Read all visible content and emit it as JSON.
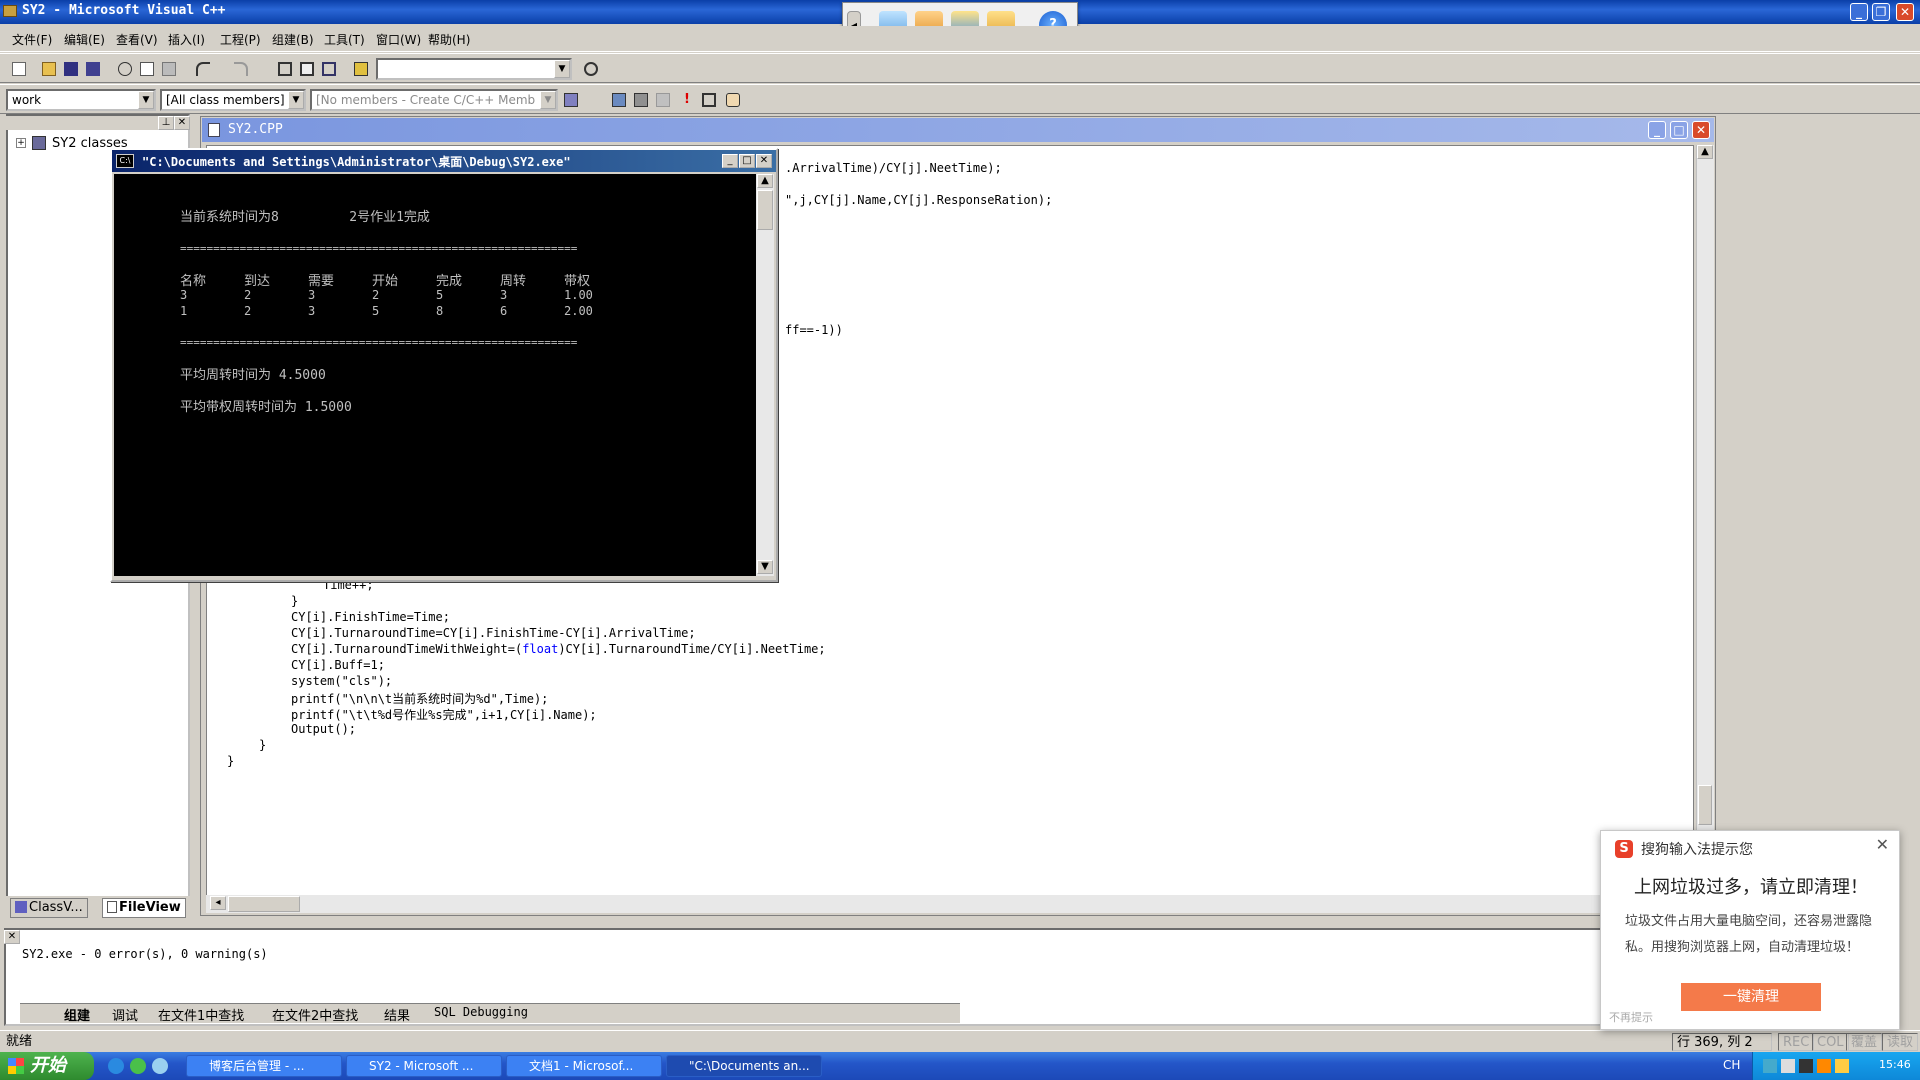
{
  "window": {
    "title": "SY2 - Microsoft Visual C++"
  },
  "menu": [
    "文件(F)",
    "编辑(E)",
    "查看(V)",
    "插入(I)",
    "工程(P)",
    "组建(B)",
    "工具(T)",
    "窗口(W)",
    "帮助(H)"
  ],
  "toolbar": {
    "find_combo_value": "",
    "workspace_combo": "work",
    "class_combo": "[All class members]",
    "members_combo": "[No members - Create C/C++ Memb"
  },
  "workspace": {
    "tree_root": "SY2 classes",
    "tabs": [
      "ClassV...",
      "FileView"
    ]
  },
  "editor": {
    "file_title": "SY2.CPP",
    "code_lines_right": [
      ".ArrivalTime)/CY[j].NeetTime);",
      "\",j,CY[j].Name,CY[j].ResponseRation);",
      "ff==-1))"
    ],
    "code_lines_bottom": [
      "Time++;",
      "}",
      "CY[i].FinishTime=Time;",
      "CY[i].TurnaroundTime=CY[i].FinishTime-CY[i].ArrivalTime;",
      "CY[i].TurnaroundTimeWithWeight=(",
      "float",
      ")CY[i].TurnaroundTime/CY[i].NeetTime;",
      "CY[i].Buff=1;",
      "system(\"cls\");",
      "printf(\"\\n\\n\\t当前系统时间为%d\",Time);",
      "printf(\"\\t\\t%d号作业%s完成\",i+1,CY[i].Name);",
      "Output();",
      "}",
      "}"
    ]
  },
  "console": {
    "title": "\"C:\\Documents and Settings\\Administrator\\桌面\\Debug\\SY2.exe\"",
    "line1": "当前系统时间为8         2号作业1完成",
    "separator": "============================================================",
    "headers": [
      "名称",
      "到达",
      "需要",
      "开始",
      "完成",
      "周转",
      "带权"
    ],
    "rows": [
      [
        "3",
        "2",
        "3",
        "2",
        "5",
        "3",
        "1.00"
      ],
      [
        "1",
        "2",
        "3",
        "5",
        "8",
        "6",
        "2.00"
      ]
    ],
    "avg_turnaround": "平均周转时间为 4.5000",
    "avg_weighted": "平均带权周转时间为 1.5000"
  },
  "output": {
    "text": "SY2.exe - 0 error(s), 0 warning(s)",
    "tabs": [
      "组建",
      "调试",
      "在文件1中查找",
      "在文件2中查找",
      "结果",
      "SQL Debugging"
    ]
  },
  "status": {
    "ready": "就绪",
    "position": "行 369, 列 2",
    "rec": "REC",
    "col": "COL",
    "ovr": "覆盖",
    "read": "读取"
  },
  "sogou": {
    "header": "搜狗输入法提示您",
    "headline": "上网垃圾过多，请立即清理！",
    "body": "垃圾文件占用大量电脑空间，还容易泄露隐私。用搜狗浏览器上网，自动清理垃圾！",
    "button": "一键清理",
    "footer": "不再提示"
  },
  "taskbar": {
    "start": "开始",
    "items": [
      "博客后台管理 - ...",
      "SY2 - Microsoft ...",
      "文档1 - Microsof...",
      "\"C:\\Documents an..."
    ],
    "tray_lang": "CH",
    "clock": "15:46"
  }
}
